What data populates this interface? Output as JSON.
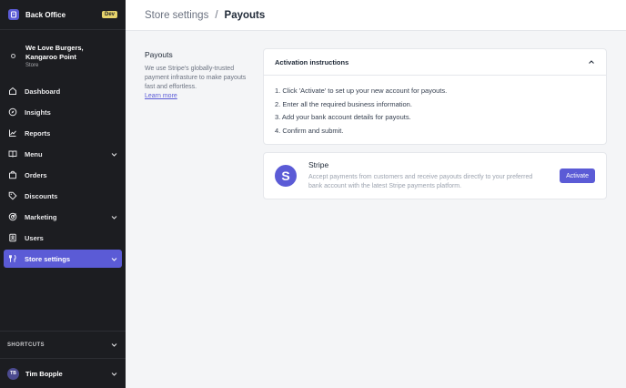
{
  "app": {
    "title": "Back Office",
    "env_badge": "Dev"
  },
  "store": {
    "name_line1": "We Love Burgers,",
    "name_line2": "Kangaroo Point",
    "type": "Store"
  },
  "nav": {
    "items": [
      {
        "label": "Dashboard",
        "icon": "home-icon"
      },
      {
        "label": "Insights",
        "icon": "compass-icon"
      },
      {
        "label": "Reports",
        "icon": "chart-line-icon"
      },
      {
        "label": "Menu",
        "icon": "book-open-icon",
        "expandable": true
      },
      {
        "label": "Orders",
        "icon": "shopping-bag-icon"
      },
      {
        "label": "Discounts",
        "icon": "tag-icon"
      },
      {
        "label": "Marketing",
        "icon": "target-icon",
        "expandable": true
      },
      {
        "label": "Users",
        "icon": "id-card-icon"
      },
      {
        "label": "Store settings",
        "icon": "settings-tool-icon",
        "expandable": true,
        "active": true
      }
    ]
  },
  "shortcuts": {
    "label": "SHORTCUTS"
  },
  "user": {
    "initials": "TB",
    "name": "Tim Bopple"
  },
  "header": {
    "breadcrumb_parent": "Store settings",
    "breadcrumb_separator": "/",
    "breadcrumb_current": "Payouts"
  },
  "payouts": {
    "title": "Payouts",
    "description": "We use Stripe's globally-trusted payment infrasture to make payouts fast and effortless.",
    "learn_more": "Learn more"
  },
  "instructions": {
    "title": "Activation instructions",
    "steps": [
      "1. Click 'Activate' to set up your new account for payouts.",
      "2. Enter all the required business information.",
      "3. Add your bank account details for payouts.",
      "4. Confirm and submit."
    ]
  },
  "stripe": {
    "logo_letter": "S",
    "name": "Stripe",
    "description": "Accept payments from customers and receive payouts directly to your preferred bank account with the latest Stripe payments platform.",
    "button_label": "Activate"
  },
  "colors": {
    "accent": "#5b5bd6",
    "sidebar_bg": "#1c1d21",
    "dev_badge": "#e6d36b"
  }
}
